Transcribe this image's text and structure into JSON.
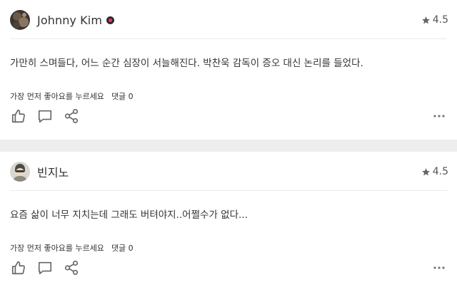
{
  "reviews": [
    {
      "user_name": "Johnny Kim",
      "has_badge": true,
      "rating": "4.5",
      "comment": "가만히 스며들다, 어느 순간 심장이 서늘해진다. 박찬욱 감독이 증오 대신 논리를 들었다.",
      "first_like_prompt": "가장 먼저 좋아요를 누르세요",
      "replies_label": "댓글 0"
    },
    {
      "user_name": "빈지노",
      "has_badge": false,
      "rating": "4.5",
      "comment": "요즘 삶이 너무 지치는데 그래도 버텨야지..어쩔수가 없다...",
      "first_like_prompt": "가장 먼저 좋아요를 누르세요",
      "replies_label": "댓글 0"
    }
  ],
  "colors": {
    "page_background": "#eeeeee",
    "card_background": "#ffffff",
    "icon": "#666666",
    "star": "#666666",
    "badge": "#ff2f6e"
  },
  "icons": [
    "star-icon",
    "thumbs-up-icon",
    "comment-icon",
    "share-icon",
    "more-icon",
    "verified-badge-icon"
  ]
}
